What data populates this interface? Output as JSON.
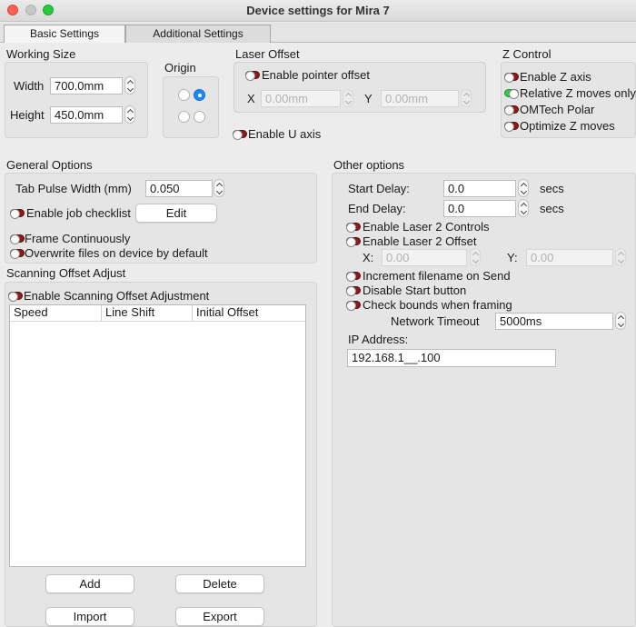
{
  "window": {
    "title": "Device settings for Mira 7"
  },
  "tabs": [
    {
      "label": "Basic Settings",
      "active": true
    },
    {
      "label": "Additional Settings",
      "active": false
    }
  ],
  "working_size": {
    "title": "Working Size",
    "width_label": "Width",
    "width_value": "700.0mm",
    "height_label": "Height",
    "height_value": "450.0mm"
  },
  "origin": {
    "title": "Origin",
    "selected": "top-right"
  },
  "laser_offset": {
    "title": "Laser Offset",
    "enable_pointer_label": "Enable pointer offset",
    "enable_pointer_on": false,
    "x_label": "X",
    "x_placeholder": "0.00mm",
    "y_label": "Y",
    "y_placeholder": "0.00mm",
    "enable_u_label": "Enable U axis",
    "enable_u_on": false
  },
  "z_control": {
    "title": "Z Control",
    "items": [
      {
        "label": "Enable Z axis",
        "on": false
      },
      {
        "label": "Relative Z moves only",
        "on": true
      },
      {
        "label": "OMTech Polar",
        "on": false
      },
      {
        "label": "Optimize Z moves",
        "on": false
      }
    ]
  },
  "general_options": {
    "title": "General Options",
    "tab_pulse_label": "Tab Pulse Width (mm)",
    "tab_pulse_value": "0.050",
    "job_checklist_label": "Enable job checklist",
    "edit_button": "Edit",
    "frame_continuously_label": "Frame Continuously",
    "overwrite_files_label": "Overwrite files on device by default"
  },
  "scanning_offset": {
    "title": "Scanning Offset Adjust",
    "enable_label": "Enable Scanning Offset Adjustment",
    "columns": [
      "Speed",
      "Line Shift",
      "Initial Offset"
    ],
    "add_button": "Add",
    "delete_button": "Delete",
    "import_button": "Import",
    "export_button": "Export"
  },
  "other_options": {
    "title": "Other options",
    "start_delay_label": "Start Delay:",
    "start_delay_value": "0.0",
    "end_delay_label": "End Delay:",
    "end_delay_value": "0.0",
    "secs_label": "secs",
    "laser2_controls_label": "Enable Laser 2 Controls",
    "laser2_offset_label": "Enable Laser 2 Offset",
    "x_label": "X:",
    "x_placeholder": "0.00",
    "y_label": "Y:",
    "y_placeholder": "0.00",
    "increment_filename_label": "Increment filename on Send",
    "disable_start_label": "Disable Start button",
    "check_bounds_label": "Check bounds when framing",
    "network_timeout_label": "Network Timeout",
    "network_timeout_value": "5000ms",
    "ip_address_label": "IP Address:",
    "ip_address_value": "192.168.1__.100"
  },
  "colors": {
    "toggle_off": "#8b1a1a",
    "toggle_on": "#34c84a",
    "radio_selected": "#1e86f5"
  }
}
